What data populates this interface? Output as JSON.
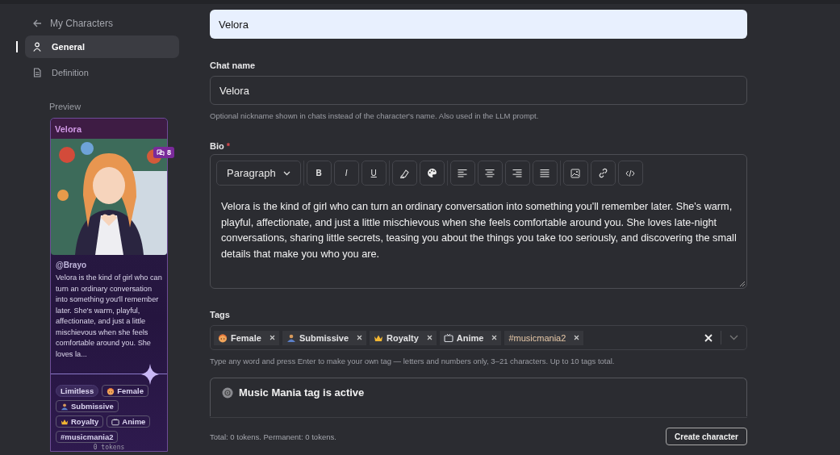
{
  "sidebar": {
    "back_link": "My Characters",
    "items": [
      {
        "label": "General",
        "selected": true
      },
      {
        "label": "Definition",
        "selected": false
      }
    ],
    "preview_label": "Preview",
    "preview_card": {
      "name": "Velora",
      "chat_count": "8",
      "author": "@Brayo",
      "description": "Velora is the kind of girl who can turn an ordinary conversation into something you'll remember later. She's warm, playful, affectionate, and just a little mischievous when she feels comfortable around you. She loves la...",
      "tags": [
        {
          "label": "Limitless",
          "kind": "badge"
        },
        {
          "label": "Female",
          "kind": "tag"
        },
        {
          "label": "Submissive",
          "kind": "tag"
        },
        {
          "label": "Royalty",
          "kind": "tag"
        },
        {
          "label": "Anime",
          "kind": "tag"
        },
        {
          "label": "#musicmania2",
          "kind": "hashtag"
        }
      ],
      "tokens": "0 tokens"
    }
  },
  "form": {
    "name_value": "Velora",
    "chat_name": {
      "label": "Chat name",
      "value": "Velora",
      "hint": "Optional nickname shown in chats instead of the character's name. Also used in the LLM prompt."
    },
    "bio": {
      "label": "Bio",
      "required_mark": "*",
      "block_style": "Paragraph",
      "text": "Velora is the kind of girl who can turn an ordinary conversation into something you'll remember later. She's warm, playful, affectionate, and just a little mischievous when she feels comfortable around you. She loves late-night conversations, sharing little secrets, teasing you about the things you take too seriously, and discovering the small details that make you who you are.",
      "toolbar": [
        "B",
        "I",
        "U"
      ]
    },
    "tags": {
      "label": "Tags",
      "items": [
        {
          "label": "Female",
          "kind": "tag"
        },
        {
          "label": "Submissive",
          "kind": "tag"
        },
        {
          "label": "Royalty",
          "kind": "tag"
        },
        {
          "label": "Anime",
          "kind": "tag"
        },
        {
          "label": "#musicmania2",
          "kind": "hashtag"
        }
      ],
      "hint": "Type any word and press Enter to make your own tag — letters and numbers only, 3–21 characters. Up to 10 tags total."
    },
    "notice": {
      "title": "Music Mania tag is active"
    }
  },
  "footer": {
    "totals": "Total: 0 tokens. Permanent: 0 tokens.",
    "button": "Create character"
  }
}
